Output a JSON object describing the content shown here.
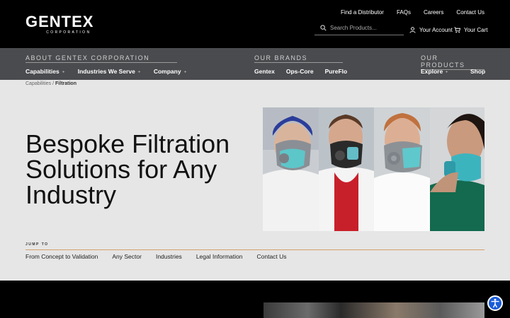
{
  "header": {
    "logo": {
      "main": "GENTEX",
      "sub": "CORPORATION"
    },
    "top_links": [
      "Find a Distributor",
      "FAQs",
      "Careers",
      "Contact Us"
    ],
    "search": {
      "placeholder": "Search Products..."
    },
    "account_label": "Your Account",
    "cart_label": "Your Cart"
  },
  "nav": {
    "about": {
      "title": "ABOUT GENTEX CORPORATION",
      "items": [
        "Capabilities",
        "Industries We Serve",
        "Company"
      ]
    },
    "brands": {
      "title": "OUR BRANDS",
      "items": [
        "Gentex",
        "Ops-Core",
        "PureFlo"
      ]
    },
    "products": {
      "title": "OUR PRODUCTS",
      "explore": "Explore",
      "shop": "Shop"
    }
  },
  "breadcrumb": {
    "parent": "Capabilities",
    "separator": " / ",
    "current": "Filtration"
  },
  "hero": {
    "title": "Bespoke Filtration Solutions for Any Industry"
  },
  "jump_to": {
    "label": "JUMP TO",
    "links": [
      "From Concept to Validation",
      "Any Sector",
      "Industries",
      "Legal Information",
      "Contact Us"
    ]
  },
  "colors": {
    "topbar": "#000000",
    "navbar": "#4a4b4e",
    "accent_line": "#d4a06a",
    "a11y_button": "#1a5cd8"
  },
  "icons": {
    "search": "search-icon",
    "account": "user-icon",
    "cart": "cart-icon",
    "accessibility": "accessibility-icon"
  }
}
